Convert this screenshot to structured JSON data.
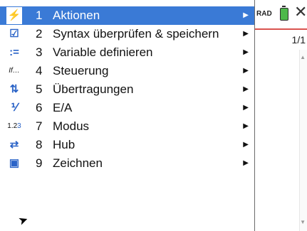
{
  "status": {
    "angle_mode": "RAD",
    "page": "1/1"
  },
  "menu": {
    "items": [
      {
        "number": "1",
        "label": "Aktionen",
        "icon": "bolt-icon"
      },
      {
        "number": "2",
        "label": "Syntax überprüfen & speichern",
        "icon": "check-save-icon"
      },
      {
        "number": "3",
        "label": "Variable definieren",
        "icon": "define-variable-icon"
      },
      {
        "number": "4",
        "label": "Steuerung",
        "icon": "if-control-icon"
      },
      {
        "number": "5",
        "label": "Übertragungen",
        "icon": "transfer-arrows-icon"
      },
      {
        "number": "6",
        "label": "E/A",
        "icon": "io-icon"
      },
      {
        "number": "7",
        "label": "Modus",
        "icon": "mode-icon"
      },
      {
        "number": "8",
        "label": "Hub",
        "icon": "hub-icon"
      },
      {
        "number": "9",
        "label": "Zeichnen",
        "icon": "draw-icon"
      }
    ]
  },
  "colors": {
    "selection": "#3a7ad6",
    "header_accent": "#d9534f",
    "battery": "#4db84a"
  }
}
